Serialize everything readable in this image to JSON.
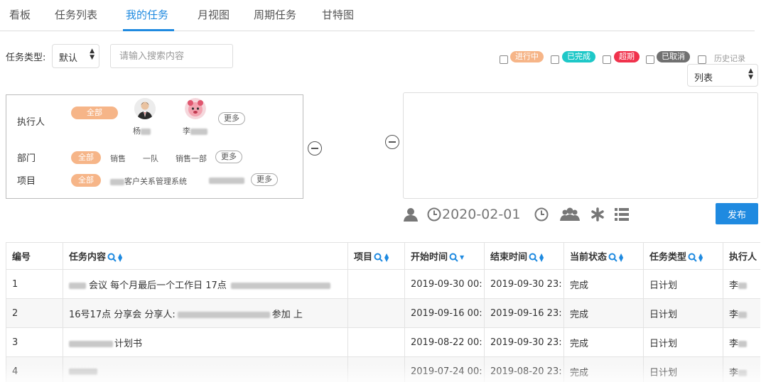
{
  "tabs": [
    {
      "label": "看板"
    },
    {
      "label": "任务列表"
    },
    {
      "label": "我的任务"
    },
    {
      "label": "月视图"
    },
    {
      "label": "周期任务"
    },
    {
      "label": "甘特图"
    }
  ],
  "active_tab": "我的任务",
  "filter": {
    "type_label": "任务类型:",
    "type_select": "默认",
    "search_placeholder": "请输入搜索内容",
    "view_select": "列表"
  },
  "statuses": [
    {
      "label": "进行中",
      "color": "#f6b588"
    },
    {
      "label": "已完成",
      "color": "#1ec8c8"
    },
    {
      "label": "超期",
      "color": "#f0324c"
    },
    {
      "label": "已取消",
      "color": "#707070"
    },
    {
      "label": "历史记录",
      "color": ""
    }
  ],
  "panel": {
    "executor_label": "执行人",
    "dept_label": "部门",
    "project_label": "项目",
    "all_label": "全部",
    "more_label": "更多",
    "executors": [
      {
        "name_prefix": "杨",
        "avatar": "person-suit-avatar"
      },
      {
        "name_prefix": "李",
        "avatar": "pink-character-avatar"
      }
    ],
    "departments": [
      "销售",
      "一队",
      "销售一部"
    ],
    "projects": [
      {
        "text": "客户关系管理系统"
      },
      {
        "text": ""
      }
    ]
  },
  "toolbar": {
    "date": "2020-02-01",
    "publish_label": "发布",
    "icons": [
      "user-icon",
      "clock-icon",
      "alarm-icon",
      "group-icon",
      "asterisk-icon",
      "list-icon"
    ]
  },
  "table": {
    "headers": [
      "编号",
      "任务内容",
      "项目",
      "开始时间",
      "结束时间",
      "当前状态",
      "任务类型",
      "执行人"
    ],
    "rows": [
      {
        "id": "1",
        "content": "会议 每个月最后一个工作日 17点",
        "project": "",
        "start": "2019-09-30 00:",
        "end": "2019-09-30 23:",
        "status": "完成",
        "type": "日计划",
        "executor": "李"
      },
      {
        "id": "2",
        "content": "16号17点  分享会 分享人:",
        "content_tail": "参加 上",
        "project": "",
        "start": "2019-09-16 00:",
        "end": "2019-09-16 23:",
        "status": "完成",
        "type": "日计划",
        "executor": "李"
      },
      {
        "id": "3",
        "content": "计划书",
        "project": "",
        "start": "2019-08-22 00:",
        "end": "2019-09-30 23:",
        "status": "完成",
        "type": "日计划",
        "executor": "李"
      },
      {
        "id": "4",
        "content": "",
        "project": "",
        "start": "2019-07-24 00:",
        "end": "2019-08-20 23:",
        "status": "完成",
        "type": "日计划",
        "executor": "李"
      }
    ]
  }
}
